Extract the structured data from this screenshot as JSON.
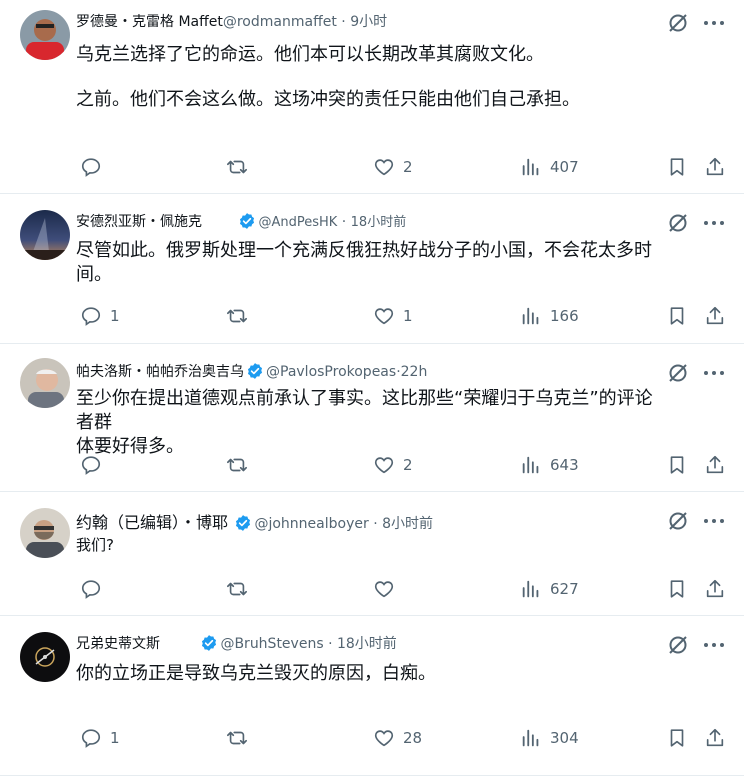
{
  "posts": [
    {
      "name": "罗德曼・克雷格 Maffet",
      "handle": "@rodmanmaffet",
      "sep": "·",
      "time": "9小时",
      "verified": false,
      "lines": [
        "乌克兰选择了它的命运。他们本可以长期改革其腐败文化。",
        "之前。他们不会这么做。这场冲突的责任只能由他们自己承担。"
      ],
      "replies": "",
      "likes": "2",
      "views": "407"
    },
    {
      "name": "安德烈亚斯・佩施克",
      "handle": "@AndPesHK",
      "sep": "·",
      "time": "18小时前",
      "verified": true,
      "lines": [
        "尽管如此。俄罗斯处理一个充满反俄狂热好战分子的小国，不会花太多时",
        "间。"
      ],
      "replies": "1",
      "likes": "1",
      "views": "166"
    },
    {
      "name": "帕夫洛斯・帕帕乔治奥吉乌",
      "handle": "@PavlosProkopeas",
      "sep": "·",
      "time": "22h",
      "verified": true,
      "lines": [
        "至少你在提出道德观点前承认了事实。这比那些“荣耀归于乌克兰”的评论者群",
        "体要好得多。"
      ],
      "replies": "",
      "likes": "2",
      "views": "643"
    },
    {
      "name": "约翰（已编辑）・博耶",
      "handle": "@johnnealboyer",
      "sep": "·",
      "time": "8小时前",
      "verified": true,
      "lines": [
        "我们?"
      ],
      "replies": "",
      "likes": "",
      "views": "627"
    },
    {
      "name": "兄弟史蒂文斯",
      "handle": "@BruhStevens",
      "sep": "·",
      "time": "18小时前",
      "verified": true,
      "lines": [
        "你的立场正是导致乌克兰毁灭的原因，白痴。"
      ],
      "replies": "1",
      "likes": "28",
      "views": "304"
    }
  ],
  "icons": {
    "reply": "reply-icon",
    "repost": "repost-icon",
    "like": "heart-icon",
    "views": "views-icon",
    "bookmark": "bookmark-icon",
    "share": "share-icon",
    "grok": "grok-icon",
    "more": "more-icon"
  },
  "colors": {
    "verified": "#1d9bf0",
    "text": "#0f1419",
    "muted": "#536471",
    "divider": "#e6ecf0"
  }
}
